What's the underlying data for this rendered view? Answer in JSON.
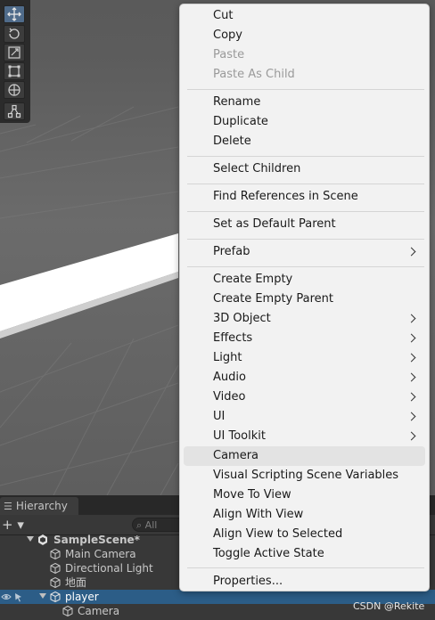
{
  "menu": {
    "cut": "Cut",
    "copy": "Copy",
    "paste": "Paste",
    "paste_as_child": "Paste As Child",
    "rename": "Rename",
    "duplicate": "Duplicate",
    "delete": "Delete",
    "select_children": "Select Children",
    "find_references": "Find References in Scene",
    "set_default_parent": "Set as Default Parent",
    "prefab": "Prefab",
    "create_empty": "Create Empty",
    "create_empty_parent": "Create Empty Parent",
    "object_3d": "3D Object",
    "effects": "Effects",
    "light": "Light",
    "audio": "Audio",
    "video": "Video",
    "ui": "UI",
    "ui_toolkit": "UI Toolkit",
    "camera": "Camera",
    "visual_scripting": "Visual Scripting Scene Variables",
    "move_to_view": "Move To View",
    "align_with_view": "Align With View",
    "align_view_to_selected": "Align View to Selected",
    "toggle_active": "Toggle Active State",
    "properties": "Properties..."
  },
  "hierarchy": {
    "tab_label": "Hierarchy",
    "add_label": "+ ▾",
    "search_placeholder": "All",
    "scene_name": "SampleScene*",
    "items": {
      "main_camera": "Main Camera",
      "directional_light": "Directional Light",
      "ground": "地面",
      "player": "player",
      "camera": "Camera"
    }
  },
  "watermark": "CSDN @Rekite",
  "colors": {
    "selection": "#2c5d87",
    "menu_bg": "#f2f2f2",
    "menu_highlight": "#e3e3e3",
    "disabled_text": "#9a9a9a"
  },
  "icons": [
    "move-tool-icon",
    "rotate-tool-icon",
    "scale-tool-icon",
    "rect-tool-icon",
    "transform-tool-icon",
    "custom-tool-icon",
    "hierarchy-list-icon",
    "search-icon",
    "unity-scene-icon",
    "gameobject-icon",
    "visibility-icon",
    "pickability-icon",
    "chevron-right-icon"
  ]
}
